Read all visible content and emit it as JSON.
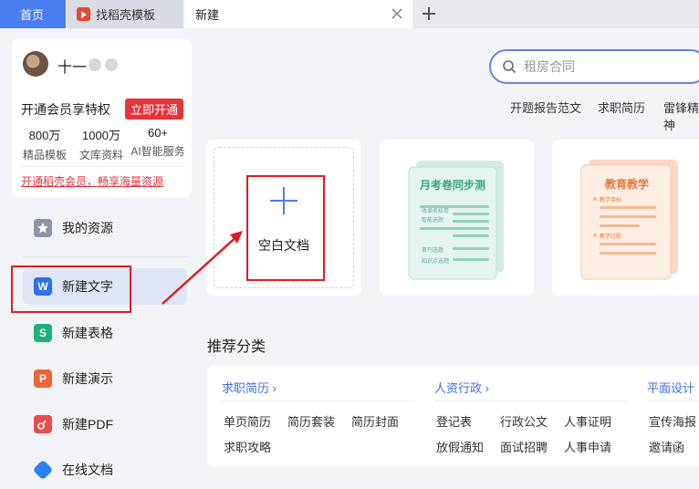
{
  "tabs": {
    "home": "首页",
    "template": "找稻壳模板",
    "new": "新建"
  },
  "user": {
    "name": "十一",
    "vip_text": "开通会员享特权",
    "vip_button": "立即开通",
    "stats": [
      {
        "num": "800万",
        "label": "精品模板"
      },
      {
        "num": "1000万",
        "label": "文库资料"
      },
      {
        "num": "60+",
        "label": "AI智能服务"
      }
    ],
    "promo": "开通稻壳会员，畅享海量资源"
  },
  "nav": {
    "my_resources": "我的资源",
    "new_writer": "新建文字",
    "new_sheet": "新建表格",
    "new_slides": "新建演示",
    "new_pdf": "新建PDF",
    "online_doc": "在线文档"
  },
  "search": {
    "placeholder": "租房合同"
  },
  "hot_words": [
    "开题报告范文",
    "求职简历",
    "雷锋精神"
  ],
  "cards": {
    "blank": "空白文档",
    "exam_title": "月考卷同步测",
    "exam_items": [
      "·收录名校卷",
      "·智能选题",
      "·首刊选题",
      "·知识点选题"
    ],
    "edu_title": "教育教学",
    "edu_items": [
      "教学目标",
      "教学过程"
    ]
  },
  "recommend": {
    "title": "推荐分类",
    "groups": [
      {
        "head": "求职简历",
        "links": [
          "单页简历",
          "简历套装",
          "简历封面",
          "求职攻略"
        ]
      },
      {
        "head": "人资行政",
        "links": [
          "登记表",
          "行政公文",
          "人事证明",
          "放假通知",
          "面试招聘",
          "人事申请"
        ]
      },
      {
        "head": "平面设计",
        "links": [
          "宣传海报",
          "邀请函"
        ]
      }
    ]
  },
  "colors": {
    "accent": "#4a7df0",
    "annotation_red": "#e01c22",
    "vip_red": "#e8343b"
  }
}
